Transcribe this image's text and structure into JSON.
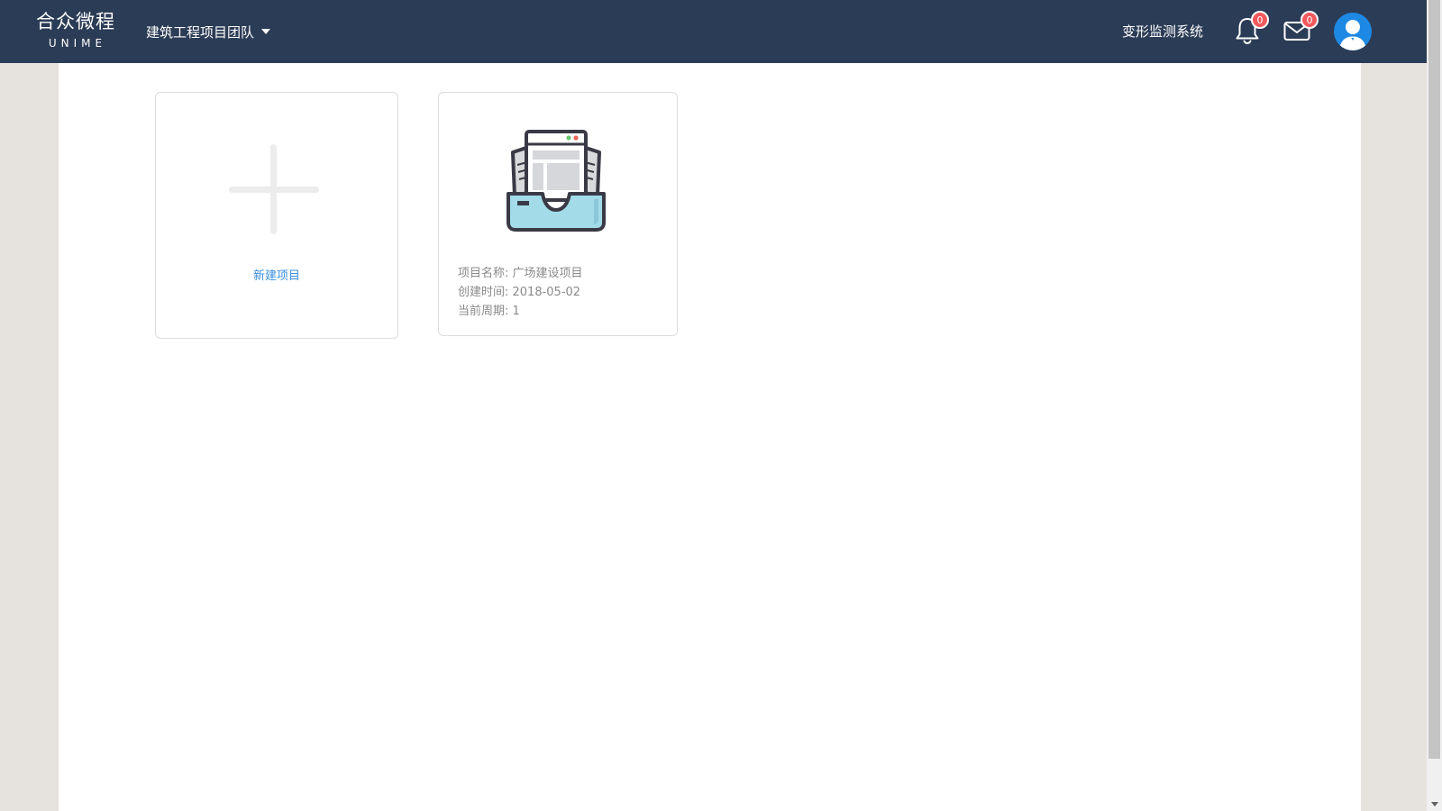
{
  "header": {
    "logo_cn": "合众微程",
    "logo_en": "UNIME",
    "team_name": "建筑工程项目团队",
    "system_link": "变形监测系统",
    "notifications_count": "0",
    "messages_count": "0"
  },
  "projects": {
    "new_label": "新建项目",
    "items": [
      {
        "name_line": "项目名称: 广场建设项目",
        "created_line": "创建时间: 2018-05-02",
        "period_line": "当前周期: 1"
      }
    ]
  },
  "colors": {
    "header_bg": "#2b3c56",
    "accent_link": "#3b8fdc",
    "badge": "#f1595d",
    "avatar_bg": "#1e88e5",
    "page_side_bg": "#e6e3df"
  },
  "icons": {
    "bell": "bell-icon",
    "mail": "mail-icon",
    "avatar": "user-avatar-icon",
    "project": "inbox-documents-icon",
    "add": "plus-icon"
  }
}
